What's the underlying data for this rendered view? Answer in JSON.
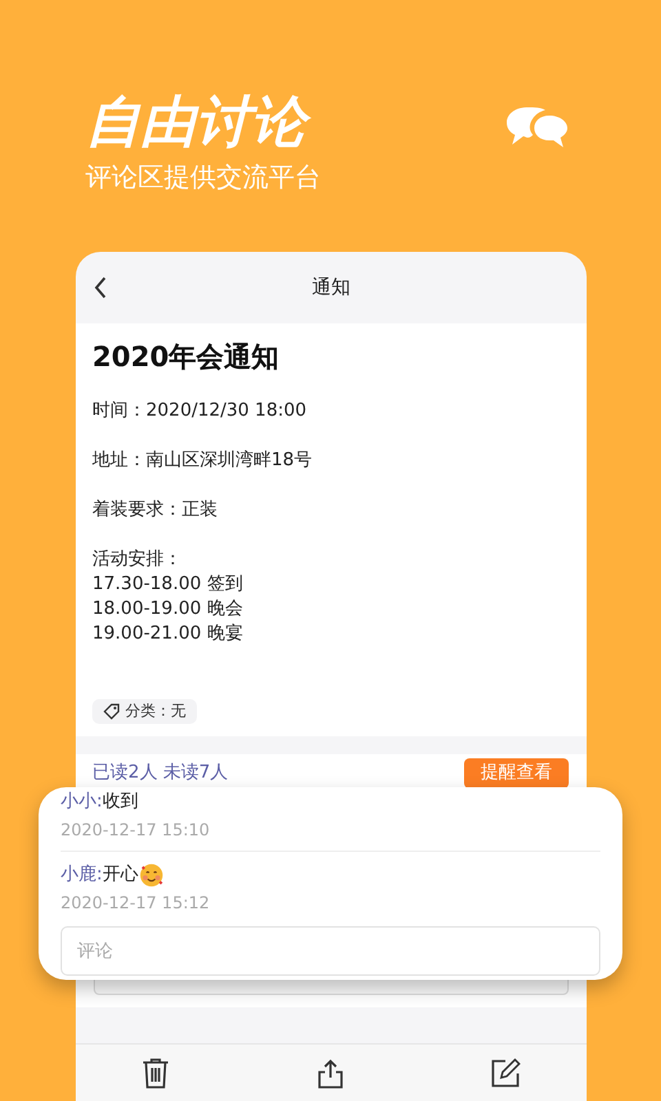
{
  "banner": {
    "title": "自由讨论",
    "subtitle": "评论区提供交流平台"
  },
  "notice": {
    "nav_title": "通知",
    "title": "2020年会通知",
    "paragraphs": [
      [
        "时间：2020/12/30 18:00"
      ],
      [
        "地址：南山区深圳湾畔18号"
      ],
      [
        "着装要求：正装"
      ],
      [
        "活动安排：",
        "17.30-18.00 签到",
        "18.00-19.00 晚会",
        "19.00-21.00 晚宴"
      ]
    ],
    "category": "分类：无",
    "read_status": "已读2人 未读7人",
    "remind_button": "提醒查看"
  },
  "comments": [
    {
      "author": "小小:",
      "text": "收到",
      "time": "2020-12-17 15:10",
      "emoji": false
    },
    {
      "author": "小鹿:",
      "text": "开心",
      "time": "2020-12-17 15:12",
      "emoji": true
    }
  ],
  "comment_field": {
    "placeholder": "评论"
  }
}
